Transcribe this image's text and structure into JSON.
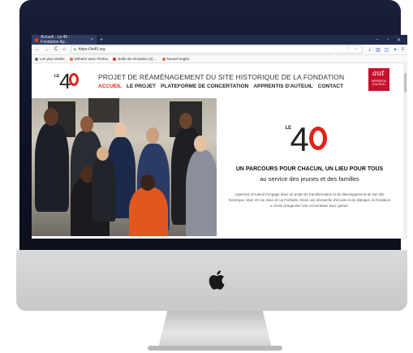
{
  "browser": {
    "tab_title": "Accueil - Le 40 - Fondation Ap...",
    "tab_close": "×",
    "new_tab": "+",
    "window_controls": [
      "–",
      "▫",
      "✕"
    ],
    "url": "https://le40.org",
    "nav_icons": [
      "←",
      "→",
      "C",
      "⌂"
    ],
    "url_actions": "··· ♡ ☆",
    "bookmarks": [
      {
        "label": "Les plus visités",
        "color": "#6a6a6a"
      },
      {
        "label": "Débuter avec Firefox",
        "color": "#e8683b"
      },
      {
        "label": "Boîte de réception (4) ...",
        "color": "#d93025"
      },
      {
        "label": "Nouvel onglet",
        "color": "#e8683b"
      }
    ]
  },
  "site": {
    "logo_le": "LE",
    "logo_four": "4",
    "title": "PROJET DE RÉAMÉNAGEMENT DU SITE HISTORIQUE DE LA FONDATION",
    "nav": [
      "ACCUEIL",
      "LE PROJET",
      "PLATEFORME DE CONCERTATION",
      "APPRENTIS D'AUTEUIL",
      "CONTACT"
    ],
    "partner": {
      "swirl": "aut",
      "line1": "APPRENTIS",
      "line2": "D'AUTEUIL"
    },
    "hero": {
      "logo_le": "LE",
      "logo_four": "4",
      "tagline": "UN PARCOURS POUR CHACUN, UN LIEU POUR TOUS",
      "subtagline": "au service des jeunes et des familles",
      "intro": "Apprentis d'Auteuil s'engage dans un projet de transformation et de développement de son site historique, situé 40 rue Jean de La Fontaine. Dans une démarche d'écoute et de dialogue, la fondation a choisi d'organiser une concertation avec garant."
    }
  },
  "colors": {
    "accent": "#e2201a",
    "browser_dark": "#1f2b4a",
    "partner": "#c8102e"
  },
  "icons": {
    "apple": "apple-logo-icon"
  }
}
